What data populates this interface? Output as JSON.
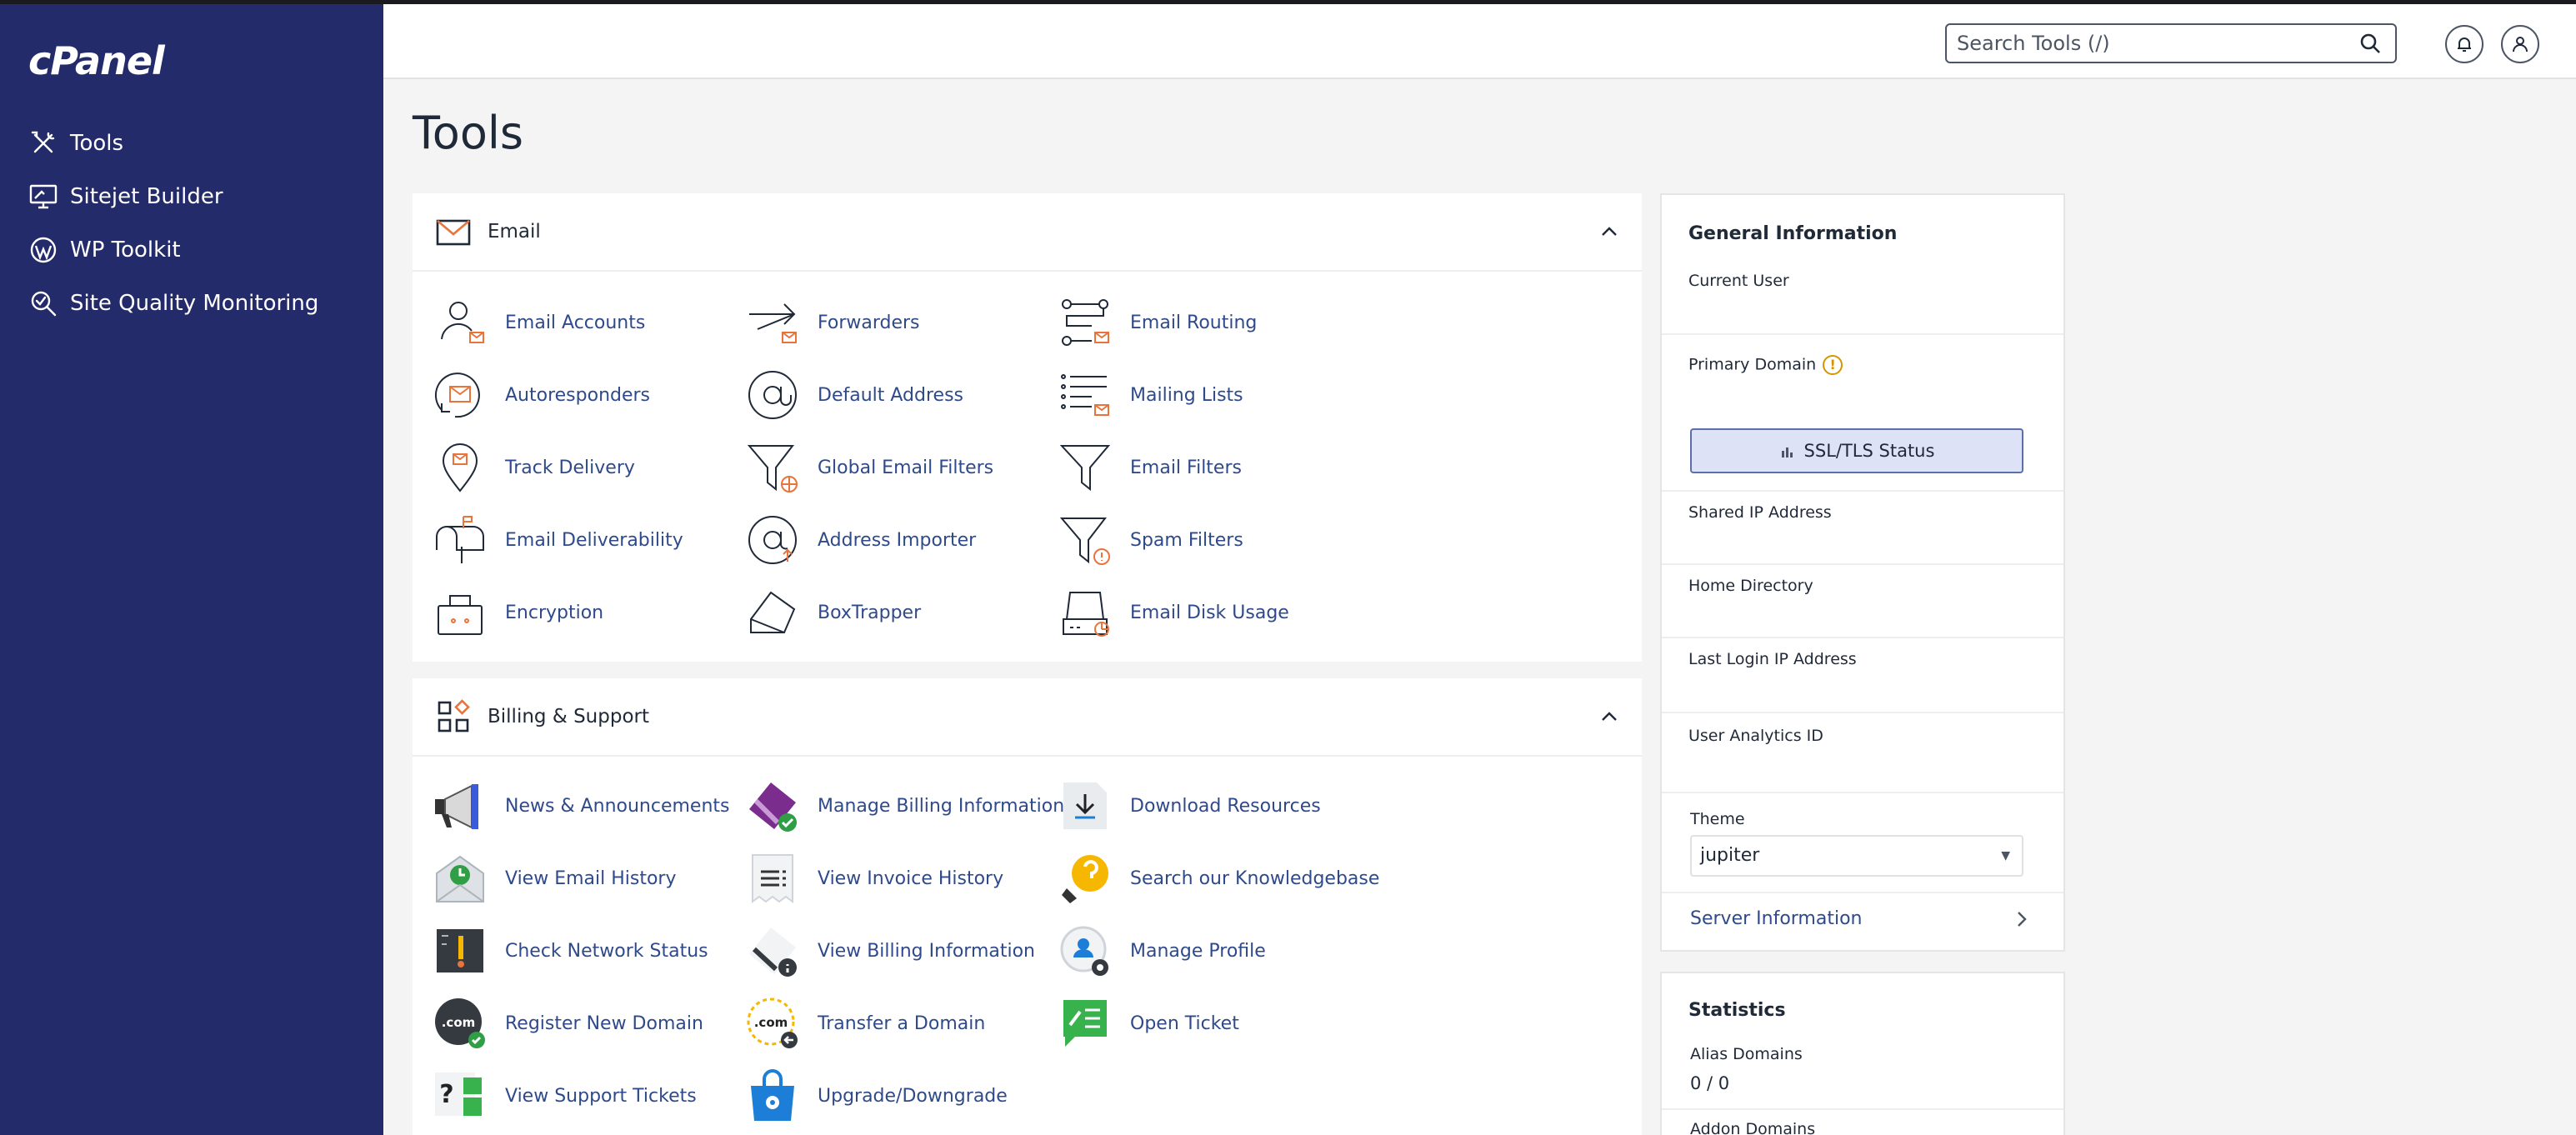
{
  "brand": {
    "logo": "cPanel"
  },
  "sidebar": {
    "items": [
      {
        "label": "Tools",
        "icon": "tools-icon"
      },
      {
        "label": "Sitejet Builder",
        "icon": "monitor-icon"
      },
      {
        "label": "WP Toolkit",
        "icon": "wordpress-icon"
      },
      {
        "label": "Site Quality Monitoring",
        "icon": "magnifier-icon"
      }
    ]
  },
  "header": {
    "search_placeholder": "Search Tools (/)"
  },
  "page": {
    "title": "Tools"
  },
  "email": {
    "title": "Email",
    "tools": [
      "Email Accounts",
      "Forwarders",
      "Email Routing",
      "Autoresponders",
      "Default Address",
      "Mailing Lists",
      "Track Delivery",
      "Global Email Filters",
      "Email Filters",
      "Email Deliverability",
      "Address Importer",
      "Spam Filters",
      "Encryption",
      "BoxTrapper",
      "Email Disk Usage"
    ]
  },
  "billing": {
    "title": "Billing & Support",
    "tools": [
      "News & Announcements",
      "Manage Billing Information",
      "Download Resources",
      "View Email History",
      "View Invoice History",
      "Search our Knowledgebase",
      "Check Network Status",
      "View Billing Information",
      "Manage Profile",
      "Register New Domain",
      "Transfer a Domain",
      "Open Ticket",
      "View Support Tickets",
      "Upgrade/Downgrade"
    ]
  },
  "general": {
    "title": "General Information",
    "current_user": "Current User",
    "primary_domain": "Primary Domain",
    "ssl_button": "SSL/TLS Status",
    "shared_ip": "Shared IP Address",
    "home_dir": "Home Directory",
    "last_login": "Last Login IP Address",
    "analytics": "User Analytics ID",
    "theme_label": "Theme",
    "theme_value": "jupiter",
    "server_info": "Server Information"
  },
  "stats": {
    "title": "Statistics",
    "alias_label": "Alias Domains",
    "alias_value": "0 / 0",
    "addon_label": "Addon Domains"
  },
  "colors": {
    "sidebar": "#242b6b",
    "link": "#2f4a8a",
    "accent_orange": "#e8743b"
  }
}
